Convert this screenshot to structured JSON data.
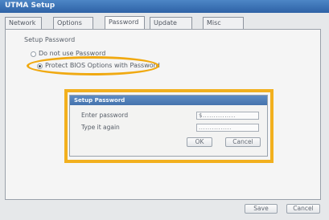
{
  "window": {
    "title": "UTMA Setup"
  },
  "tabs": [
    {
      "label": "Network"
    },
    {
      "label": "Options"
    },
    {
      "label": "Password"
    },
    {
      "label": "Update"
    },
    {
      "label": "Misc"
    }
  ],
  "password_tab": {
    "group_label": "Setup Password",
    "radio_options": [
      {
        "label": "Do not use Password",
        "selected": false
      },
      {
        "label": "Protect BIOS Options with Password",
        "selected": true
      }
    ]
  },
  "dialog": {
    "title": "Setup Password",
    "enter_label": "Enter password",
    "enter_value": "$...............",
    "retype_label": "Type it again",
    "retype_value": "...............",
    "ok_label": "OK",
    "cancel_label": "Cancel"
  },
  "footer": {
    "save_label": "Save",
    "cancel_label": "Cancel"
  },
  "colors": {
    "titlebar": "#3a71b5",
    "highlight": "#f0a911",
    "dialog_title": "#4f7db6"
  }
}
